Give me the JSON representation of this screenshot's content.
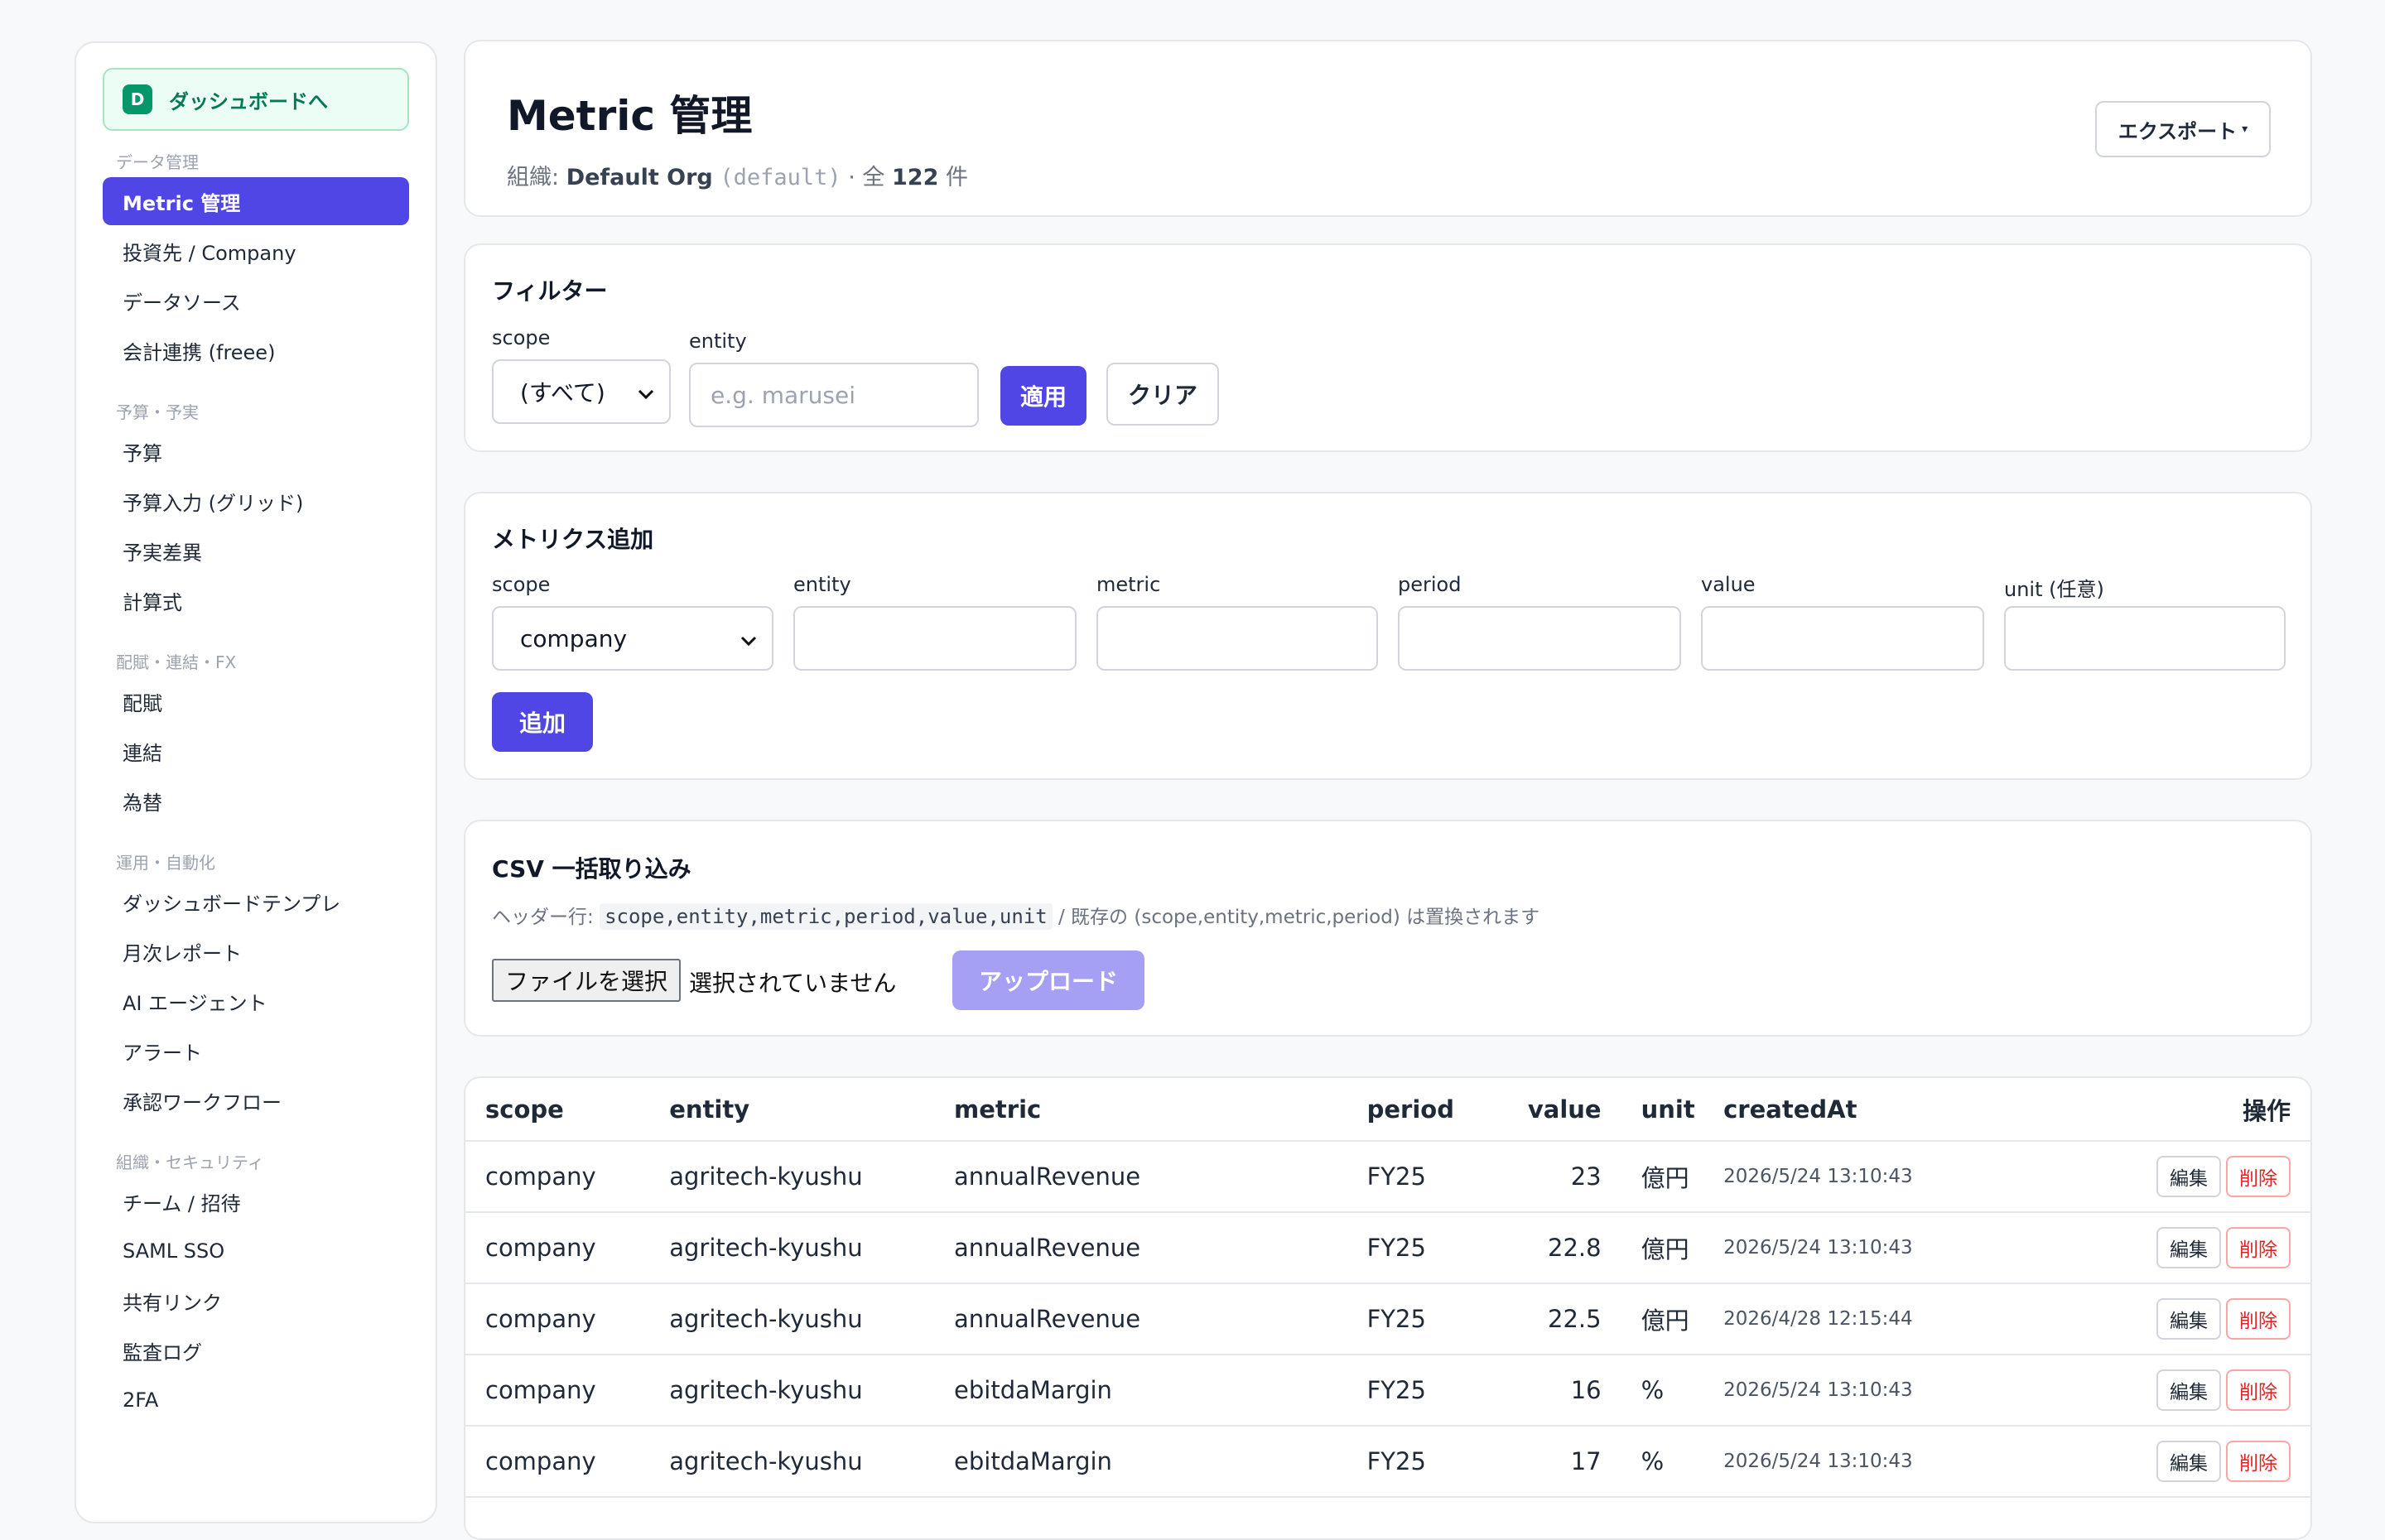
{
  "sidebar": {
    "dashboard_badge": "D",
    "dashboard_label": "ダッシュボードへ",
    "sections": [
      {
        "title": "データ管理",
        "items": [
          "Metric 管理",
          "投資先 / Company",
          "データソース",
          "会計連携 (freee)"
        ]
      },
      {
        "title": "予算・予実",
        "items": [
          "予算",
          "予算入力 (グリッド)",
          "予実差異",
          "計算式"
        ]
      },
      {
        "title": "配賦・連結・FX",
        "items": [
          "配賦",
          "連結",
          "為替"
        ]
      },
      {
        "title": "運用・自動化",
        "items": [
          "ダッシュボードテンプレ",
          "月次レポート",
          "AI エージェント",
          "アラート",
          "承認ワークフロー"
        ]
      },
      {
        "title": "組織・セキュリティ",
        "items": [
          "チーム / 招待",
          "SAML SSO",
          "共有リンク",
          "監査ログ",
          "2FA"
        ]
      }
    ]
  },
  "header": {
    "title": "Metric 管理",
    "org_label": "組織: ",
    "org_name": "Default Org",
    "org_slug": "(default)",
    "count_prefix": " · 全 ",
    "count": "122",
    "count_suffix": " 件",
    "export_label": "エクスポート"
  },
  "filter": {
    "title": "フィルター",
    "scope_label": "scope",
    "scope_value": "(すべて)",
    "entity_label": "entity",
    "entity_placeholder": "e.g. marusei",
    "apply_label": "適用",
    "clear_label": "クリア"
  },
  "add_metric": {
    "title": "メトリクス追加",
    "scope_label": "scope",
    "scope_value": "company",
    "entity_label": "entity",
    "metric_label": "metric",
    "period_label": "period",
    "value_label": "value",
    "unit_label": "unit (任意)",
    "add_label": "追加"
  },
  "csv": {
    "title": "CSV 一括取り込み",
    "hint_prefix": "ヘッダー行: ",
    "hint_code": "scope,entity,metric,period,value,unit",
    "hint_suffix": " / 既存の (scope,entity,metric,period) は置換されます",
    "file_button": "ファイルを選択",
    "file_status": "選択されていません",
    "upload_label": "アップロード"
  },
  "table": {
    "headers": [
      "scope",
      "entity",
      "metric",
      "period",
      "value",
      "unit",
      "createdAt",
      "操作"
    ],
    "rows": [
      [
        "company",
        "agritech-kyushu",
        "annualRevenue",
        "FY25",
        "23",
        "億円",
        "2026/5/24 13:10:43"
      ],
      [
        "company",
        "agritech-kyushu",
        "annualRevenue",
        "FY25",
        "22.8",
        "億円",
        "2026/5/24 13:10:43"
      ],
      [
        "company",
        "agritech-kyushu",
        "annualRevenue",
        "FY25",
        "22.5",
        "億円",
        "2026/4/28 12:15:44"
      ],
      [
        "company",
        "agritech-kyushu",
        "ebitdaMargin",
        "FY25",
        "16",
        "%",
        "2026/5/24 13:10:43"
      ],
      [
        "company",
        "agritech-kyushu",
        "ebitdaMargin",
        "FY25",
        "17",
        "%",
        "2026/5/24 13:10:43"
      ]
    ],
    "edit_label": "編集",
    "delete_label": "削除"
  },
  "colors": {
    "primary": "#4f46e5",
    "dashboard_accent": "#059669",
    "danger": "#dc2626"
  }
}
